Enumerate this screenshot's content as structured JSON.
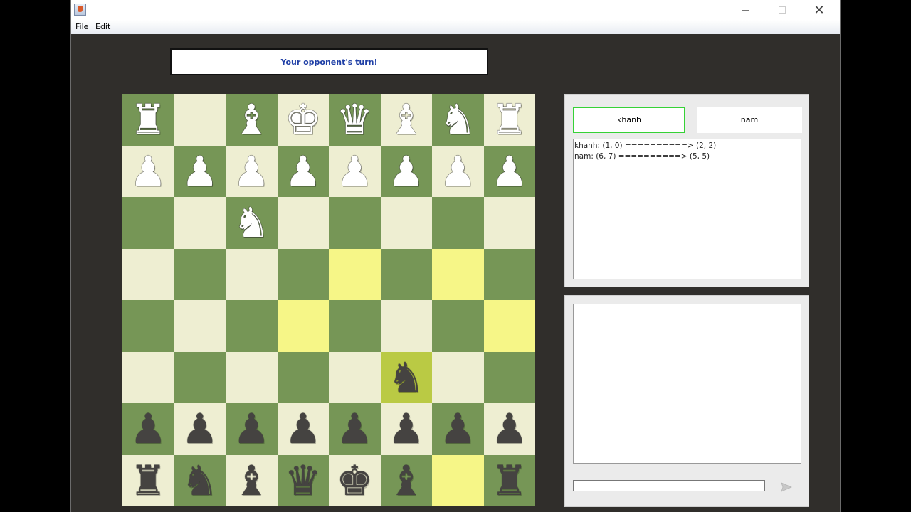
{
  "menu": {
    "file": "File",
    "edit": "Edit"
  },
  "window": {
    "minimize_glyph": "",
    "close_glyph": "✕"
  },
  "status": "Your opponent's turn!",
  "players": {
    "p1": "khanh",
    "p2": "nam"
  },
  "moves": [
    "khanh: (1, 0) ==========> (2, 2)",
    "nam: (6, 7) ==========> (5, 5)"
  ],
  "chat": {
    "input_value": ""
  },
  "board": {
    "rows": [
      [
        "wr",
        "",
        "wb",
        "wk",
        "wq",
        "wb",
        "wn",
        "wr"
      ],
      [
        "wp",
        "wp",
        "wp",
        "wp",
        "wp",
        "wp",
        "wp",
        "wp"
      ],
      [
        "",
        "",
        "wn",
        "",
        "",
        "",
        "",
        ""
      ],
      [
        "",
        "",
        "",
        "",
        "",
        "",
        "",
        ""
      ],
      [
        "",
        "",
        "",
        "",
        "",
        "",
        "",
        ""
      ],
      [
        "",
        "",
        "",
        "",
        "",
        "bn",
        "",
        ""
      ],
      [
        "bp",
        "bp",
        "bp",
        "bp",
        "bp",
        "bp",
        "bp",
        "bp"
      ],
      [
        "br",
        "bn",
        "bb",
        "bq",
        "bk",
        "bb",
        "",
        "br"
      ]
    ],
    "highlighted_squares": [
      [
        3,
        4
      ],
      [
        3,
        6
      ],
      [
        4,
        3
      ],
      [
        4,
        7
      ],
      [
        7,
        6
      ]
    ],
    "selected_square": [
      5,
      5
    ],
    "colors": {
      "light": "#eeeed2",
      "dark": "#769656",
      "highlight": "#f6f687",
      "selected": "#baca44"
    }
  },
  "icons": {
    "send": "send-icon",
    "app": "java-icon"
  }
}
